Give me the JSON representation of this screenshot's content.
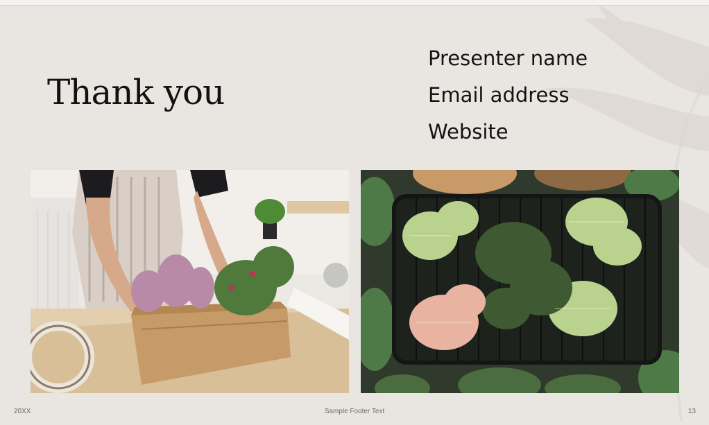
{
  "slide": {
    "title": "Thank you",
    "contact": {
      "presenter": "Presenter name",
      "email": "Email address",
      "website": "Website"
    },
    "footer": {
      "date": "20XX",
      "text": "Sample Footer Text",
      "page_number": "13"
    },
    "images": {
      "left": "photo-planting-flower-box",
      "right": "photo-basket-of-fittonia-plants"
    },
    "colors": {
      "background": "#e9e6e2",
      "title": "#111111"
    }
  }
}
